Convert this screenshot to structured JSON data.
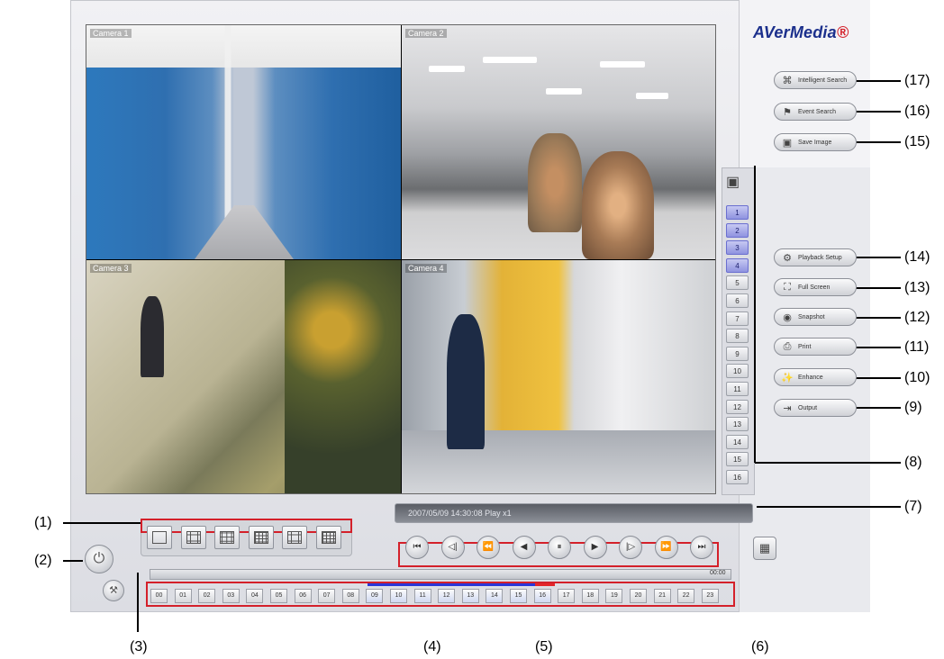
{
  "brand": {
    "name_main": "AVerMedia",
    "dot": "®"
  },
  "cameras": [
    {
      "label": "Camera 1"
    },
    {
      "label": "Camera 2"
    },
    {
      "label": "Camera 3"
    },
    {
      "label": "Camera 4"
    }
  ],
  "status_text": "2007/05/09 14:30:08 Play x1",
  "time_readout": "00:00",
  "channels": [
    "1",
    "2",
    "3",
    "4",
    "5",
    "6",
    "7",
    "8",
    "9",
    "10",
    "11",
    "12",
    "13",
    "14",
    "15",
    "16"
  ],
  "active_channels": 4,
  "side_buttons": [
    {
      "label": "Intelligent Search",
      "icon": "search-camera-icon",
      "glyph": "⌘"
    },
    {
      "label": "Event Search",
      "icon": "event-search-icon",
      "glyph": "⚑"
    },
    {
      "label": "Save Image",
      "icon": "save-image-icon",
      "glyph": "▣"
    },
    {
      "label": "Playback Setup",
      "icon": "playback-setup-icon",
      "glyph": "⚙"
    },
    {
      "label": "Full Screen",
      "icon": "fullscreen-icon",
      "glyph": "⛶"
    },
    {
      "label": "Snapshot",
      "icon": "snapshot-icon",
      "glyph": "◉"
    },
    {
      "label": "Print",
      "icon": "print-icon",
      "glyph": "⎙"
    },
    {
      "label": "Enhance",
      "icon": "enhance-icon",
      "glyph": "✨"
    },
    {
      "label": "Output",
      "icon": "output-icon",
      "glyph": "⇥"
    }
  ],
  "split_modes": [
    "single",
    "quad",
    "nine",
    "sixteen",
    "one-plus-five",
    "thirteen"
  ],
  "playback_buttons": [
    {
      "name": "jump-start",
      "glyph": "⏮"
    },
    {
      "name": "step-back",
      "glyph": "◁|"
    },
    {
      "name": "fast-rewind",
      "glyph": "⏪"
    },
    {
      "name": "reverse",
      "glyph": "◀"
    },
    {
      "name": "pause",
      "glyph": "⏸"
    },
    {
      "name": "play",
      "glyph": "▶"
    },
    {
      "name": "step-forward",
      "glyph": "|▷"
    },
    {
      "name": "fast-forward",
      "glyph": "⏩"
    },
    {
      "name": "jump-end",
      "glyph": "⏭"
    }
  ],
  "hours": [
    "00",
    "01",
    "02",
    "03",
    "04",
    "05",
    "06",
    "07",
    "08",
    "09",
    "10",
    "11",
    "12",
    "13",
    "14",
    "15",
    "16",
    "17",
    "18",
    "19",
    "20",
    "21",
    "22",
    "23"
  ],
  "recorded_hours": [
    "09",
    "10",
    "11",
    "12",
    "13",
    "14",
    "15",
    "16"
  ],
  "callouts": [
    "(1)",
    "(2)",
    "(3)",
    "(4)",
    "(5)",
    "(6)",
    "(7)",
    "(8)",
    "(9)",
    "(10)",
    "(11)",
    "(12)",
    "(13)",
    "(14)",
    "(15)",
    "(16)",
    "(17)"
  ],
  "colors": {
    "accent_blue": "#2a36d8",
    "accent_red": "#e3262a",
    "brand_blue": "#1b2f8c"
  }
}
